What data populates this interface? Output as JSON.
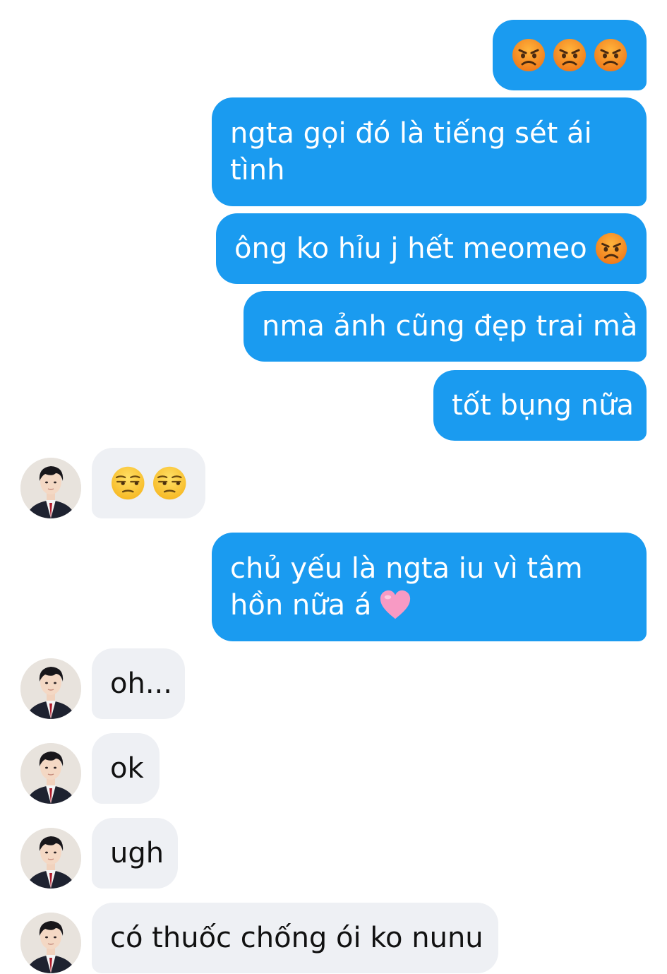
{
  "colors": {
    "outgoing_bubble": "#1a9bf0",
    "incoming_bubble": "#eef0f4",
    "outgoing_text": "#ffffff",
    "incoming_text": "#111111"
  },
  "messages": [
    {
      "direction": "outgoing",
      "type": "emoji",
      "icons": [
        "angry-face-icon",
        "angry-face-icon",
        "angry-face-icon"
      ]
    },
    {
      "direction": "outgoing",
      "lines": [
        "ngta gọi đó là tiếng sét ái",
        "tình"
      ]
    },
    {
      "direction": "outgoing",
      "text": "ông ko hỉu j hết meomeo",
      "trailing_icon": "angry-face-icon"
    },
    {
      "direction": "outgoing",
      "text": "nma ảnh cũng đẹp trai mà"
    },
    {
      "direction": "outgoing",
      "text": "tốt bụng nữa"
    },
    {
      "direction": "incoming",
      "type": "emoji",
      "icons": [
        "unamused-face-icon",
        "unamused-face-icon"
      ]
    },
    {
      "direction": "outgoing",
      "lines": [
        "chủ yếu là ngta iu vì tâm",
        "hồn nữa á"
      ],
      "trailing_icon": "pink-heart-icon"
    },
    {
      "direction": "incoming",
      "text": "oh..."
    },
    {
      "direction": "incoming",
      "text": "ok"
    },
    {
      "direction": "incoming",
      "text": "ugh"
    },
    {
      "direction": "incoming",
      "text": "có thuốc chống ói ko nunu"
    }
  ]
}
